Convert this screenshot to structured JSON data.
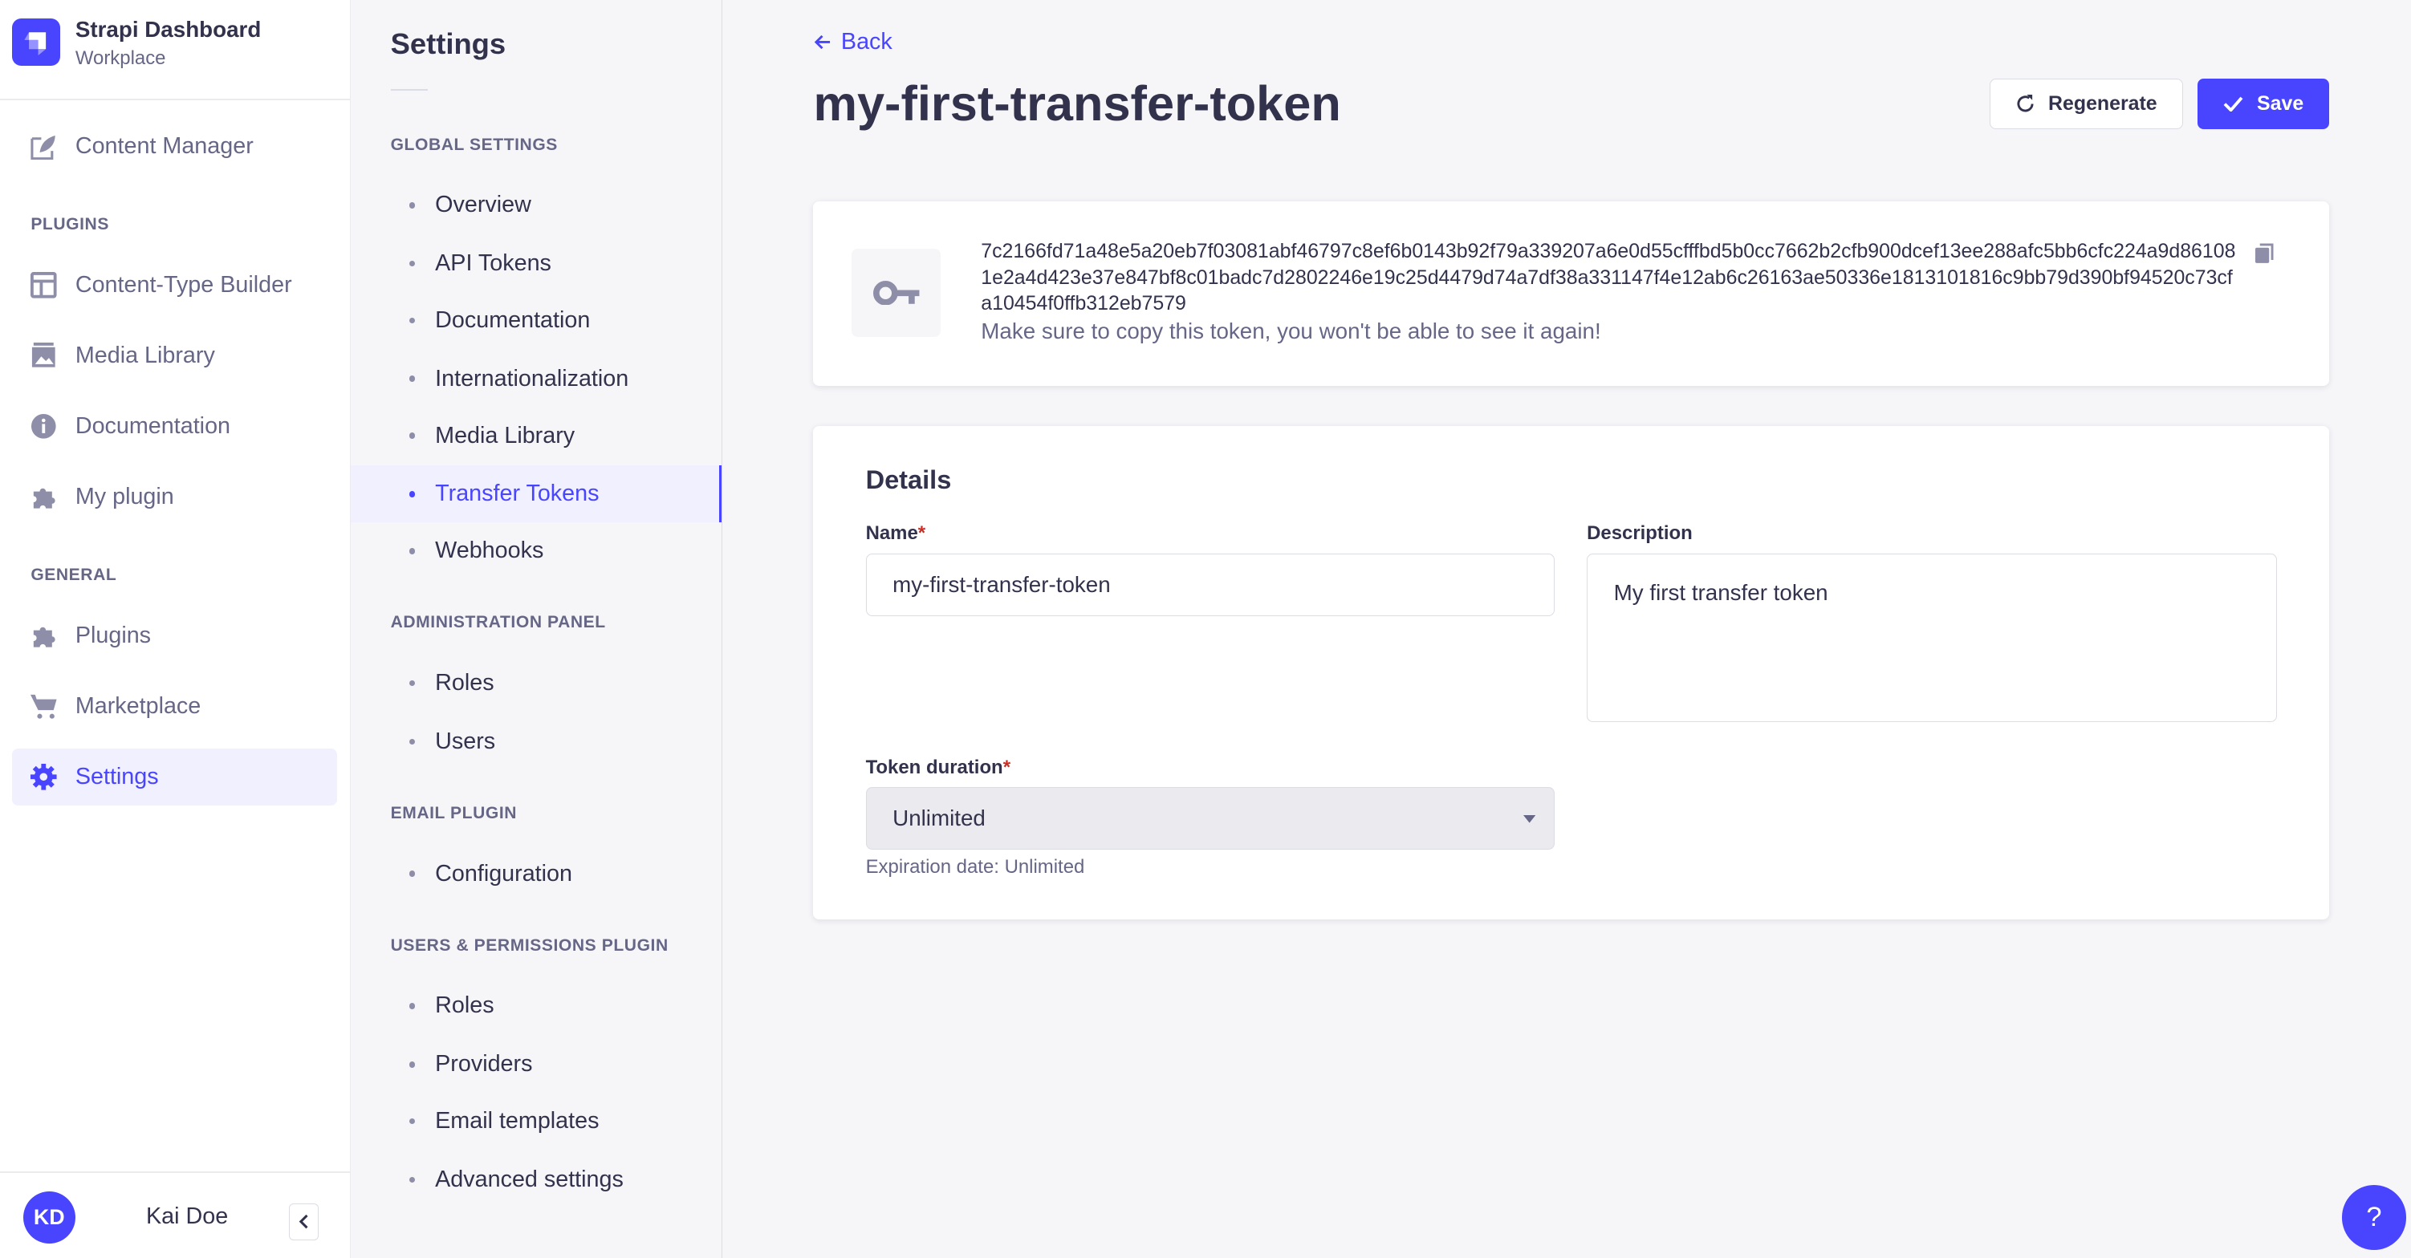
{
  "app": {
    "title": "Strapi Dashboard",
    "subtitle": "Workplace"
  },
  "nav": {
    "content_manager": "Content Manager",
    "plugins_header": "PLUGINS",
    "plugins_items": [
      "Content-Type Builder",
      "Media Library",
      "Documentation",
      "My plugin"
    ],
    "general_header": "GENERAL",
    "general_items": [
      "Plugins",
      "Marketplace",
      "Settings"
    ],
    "user": {
      "initials": "KD",
      "name": "Kai Doe"
    }
  },
  "settings": {
    "title": "Settings",
    "sections": [
      {
        "header": "GLOBAL SETTINGS",
        "items": [
          "Overview",
          "API Tokens",
          "Documentation",
          "Internationalization",
          "Media Library",
          "Transfer Tokens",
          "Webhooks"
        ]
      },
      {
        "header": "ADMINISTRATION PANEL",
        "items": [
          "Roles",
          "Users"
        ]
      },
      {
        "header": "EMAIL PLUGIN",
        "items": [
          "Configuration"
        ]
      },
      {
        "header": "USERS & PERMISSIONS PLUGIN",
        "items": [
          "Roles",
          "Providers",
          "Email templates",
          "Advanced settings"
        ]
      }
    ],
    "active": "Transfer Tokens"
  },
  "main": {
    "back": "Back",
    "title": "my-first-transfer-token",
    "regenerate": "Regenerate",
    "save": "Save",
    "token": "7c2166fd71a48e5a20eb7f03081abf46797c8ef6b0143b92f79a339207a6e0d55cfffbd5b0cc7662b2cfb900dcef13ee288afc5bb6cfc224a9d861081e2a4d423e37e847bf8c01badc7d2802246e19c25d4479d74a7df38a331147f4e12ab6c26163ae50336e1813101816c9bb79d390bf94520c73cfa10454f0ffb312eb7579",
    "token_warning": "Make sure to copy this token, you won't be able to see it again!",
    "details": {
      "title": "Details",
      "name_label": "Name",
      "name_value": "my-first-transfer-token",
      "description_label": "Description",
      "description_value": "My first transfer token",
      "duration_label": "Token duration",
      "duration_value": "Unlimited",
      "expiration": "Expiration date: Unlimited",
      "required": "*"
    }
  },
  "help": "?",
  "colors": {
    "primary": "#4945ff",
    "text": "#32324d",
    "muted": "#666687",
    "bg": "#f6f6f9",
    "required": "#d02b20"
  }
}
